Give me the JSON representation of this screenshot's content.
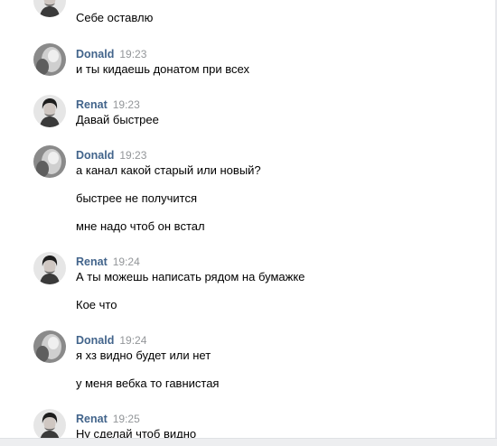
{
  "users": {
    "donald": {
      "name": "Donald",
      "avatar_icon": "blurred-photo-avatar"
    },
    "renat": {
      "name": "Renat",
      "avatar_icon": "dark-haired-man-avatar"
    }
  },
  "messages": [
    {
      "author": "renat",
      "time": "",
      "texts": [
        "Себе оставлю"
      ]
    },
    {
      "author": "donald",
      "time": "19:23",
      "texts": [
        "и ты кидаешь донатом при всех"
      ]
    },
    {
      "author": "renat",
      "time": "19:23",
      "texts": [
        "Давай быстрее"
      ]
    },
    {
      "author": "donald",
      "time": "19:23",
      "texts": [
        "а канал какой старый или новый?",
        "быстрее не получится",
        "мне надо чтоб он встал"
      ]
    },
    {
      "author": "renat",
      "time": "19:24",
      "texts": [
        "А ты можешь написать рядом на бумажке",
        "Кое что"
      ]
    },
    {
      "author": "donald",
      "time": "19:24",
      "texts": [
        "я хз видно будет или нет",
        "у меня вебка то гавнистая"
      ]
    },
    {
      "author": "renat",
      "time": "19:25",
      "texts": [
        "Ну сделай чтоб видно"
      ]
    }
  ]
}
